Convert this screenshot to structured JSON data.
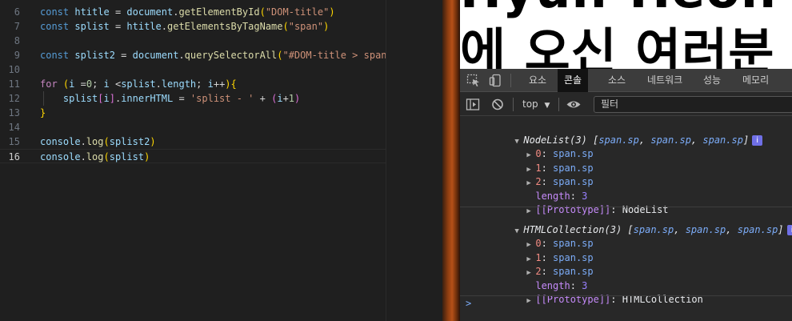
{
  "editor": {
    "lines": [
      {
        "n": "6",
        "tokens": [
          [
            "kw",
            "const "
          ],
          [
            "var",
            "htitle"
          ],
          [
            "op",
            " = "
          ],
          [
            "var",
            "document"
          ],
          [
            "op",
            "."
          ],
          [
            "fn",
            "getElementById"
          ],
          [
            "br1",
            "("
          ],
          [
            "str",
            "\"DOM-title\""
          ],
          [
            "br1",
            ")"
          ]
        ]
      },
      {
        "n": "7",
        "tokens": [
          [
            "kw",
            "const "
          ],
          [
            "var",
            "splist"
          ],
          [
            "op",
            " = "
          ],
          [
            "var",
            "htitle"
          ],
          [
            "op",
            "."
          ],
          [
            "fn",
            "getElementsByTagName"
          ],
          [
            "br1",
            "("
          ],
          [
            "str",
            "\"span\""
          ],
          [
            "br1",
            ")"
          ]
        ]
      },
      {
        "n": "8",
        "tokens": []
      },
      {
        "n": "9",
        "tokens": [
          [
            "kw",
            "const "
          ],
          [
            "var",
            "splist2"
          ],
          [
            "op",
            " = "
          ],
          [
            "var",
            "document"
          ],
          [
            "op",
            "."
          ],
          [
            "fn",
            "querySelectorAll"
          ],
          [
            "br1",
            "("
          ],
          [
            "str",
            "\"#DOM-title > span"
          ]
        ]
      },
      {
        "n": "10",
        "tokens": []
      },
      {
        "n": "11",
        "tokens": [
          [
            "cf",
            "for "
          ],
          [
            "br1",
            "("
          ],
          [
            "var",
            "i"
          ],
          [
            "op",
            " ="
          ],
          [
            "num",
            "0"
          ],
          [
            "op",
            "; "
          ],
          [
            "var",
            "i"
          ],
          [
            "op",
            " <"
          ],
          [
            "var",
            "splist"
          ],
          [
            "op",
            "."
          ],
          [
            "var",
            "length"
          ],
          [
            "op",
            "; "
          ],
          [
            "var",
            "i"
          ],
          [
            "op",
            "++"
          ],
          [
            "br1",
            ")"
          ],
          [
            "br1",
            "{"
          ]
        ]
      },
      {
        "n": "12",
        "tokens": [
          [
            "op",
            "    "
          ],
          [
            "var",
            "splist"
          ],
          [
            "br2",
            "["
          ],
          [
            "var",
            "i"
          ],
          [
            "br2",
            "]"
          ],
          [
            "op",
            "."
          ],
          [
            "var",
            "innerHTML"
          ],
          [
            "op",
            " = "
          ],
          [
            "str",
            "'splist - '"
          ],
          [
            "op",
            " + "
          ],
          [
            "br2",
            "("
          ],
          [
            "var",
            "i"
          ],
          [
            "op",
            "+"
          ],
          [
            "num",
            "1"
          ],
          [
            "br2",
            ")"
          ]
        ]
      },
      {
        "n": "13",
        "tokens": [
          [
            "br1",
            "}"
          ]
        ]
      },
      {
        "n": "14",
        "tokens": []
      },
      {
        "n": "15",
        "tokens": [
          [
            "var",
            "console"
          ],
          [
            "op",
            "."
          ],
          [
            "fn",
            "log"
          ],
          [
            "br1",
            "("
          ],
          [
            "var",
            "splist2"
          ],
          [
            "br1",
            ")"
          ]
        ]
      },
      {
        "n": "16",
        "tokens": [
          [
            "var",
            "console"
          ],
          [
            "op",
            "."
          ],
          [
            "fn",
            "log"
          ],
          [
            "br1",
            "("
          ],
          [
            "var",
            "splist"
          ],
          [
            "br1",
            ")"
          ]
        ]
      }
    ]
  },
  "preview": {
    "title_line1": "Hyun-Heon Page에",
    "title_line2": "에 오신 여러분"
  },
  "devtools": {
    "tabs": [
      "요소",
      "콘솔",
      "소스",
      "네트워크",
      "성능",
      "메모리"
    ],
    "active_tab": "콘솔",
    "context": "top",
    "filter_placeholder": "필터"
  },
  "console": {
    "group1": {
      "header_type": "NodeList(3)",
      "items": [
        "span.sp",
        "span.sp",
        "span.sp"
      ],
      "entries": [
        {
          "key": "0",
          "value": "span.sp"
        },
        {
          "key": "1",
          "value": "span.sp"
        },
        {
          "key": "2",
          "value": "span.sp"
        }
      ],
      "length_key": "length",
      "length_value": "3",
      "proto_key": "[[Prototype]]",
      "proto_value": "NodeList"
    },
    "group2": {
      "header_type": "HTMLCollection(3)",
      "items": [
        "span.sp",
        "span.sp",
        "span.sp"
      ],
      "entries": [
        {
          "key": "0",
          "value": "span.sp"
        },
        {
          "key": "1",
          "value": "span.sp"
        },
        {
          "key": "2",
          "value": "span.sp"
        }
      ],
      "length_key": "length",
      "length_value": "3",
      "proto_key": "[[Prototype]]",
      "proto_value": "HTMLCollection"
    },
    "prompt": ">"
  }
}
